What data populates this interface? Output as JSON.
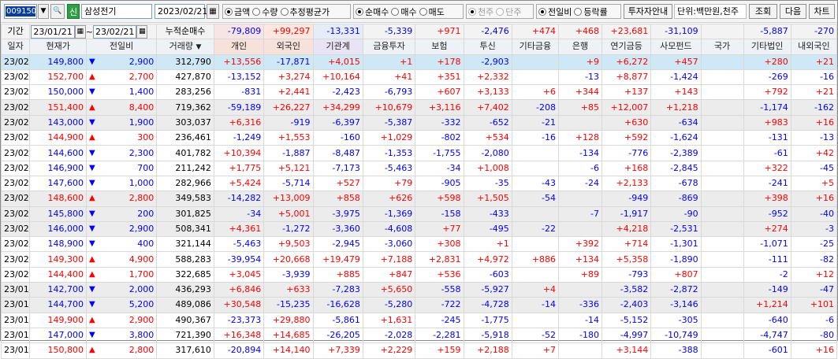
{
  "toolbar": {
    "code": "009150",
    "stock_name": "삼성전기",
    "sin_badge": "신",
    "date": "2023/02/21",
    "radio_group1": [
      {
        "label": "금액",
        "checked": true
      },
      {
        "label": "수량",
        "checked": false
      },
      {
        "label": "추정평균가",
        "checked": false
      }
    ],
    "radio_group2": [
      {
        "label": "순매수",
        "checked": true
      },
      {
        "label": "매수",
        "checked": false
      },
      {
        "label": "매도",
        "checked": false
      }
    ],
    "radio_group3": [
      {
        "label": "천주",
        "checked": true,
        "disabled": true
      },
      {
        "label": "단주",
        "checked": false,
        "disabled": true
      }
    ],
    "radio_group4": [
      {
        "label": "전일비",
        "checked": true
      },
      {
        "label": "등락률",
        "checked": false
      }
    ],
    "investor_btn": "투자자안내",
    "unit_label": "단위:백만원,천주",
    "query_btn": "조회",
    "next_btn": "다음",
    "chart_btn": "차트"
  },
  "period": {
    "label": "기간",
    "from": "23/01/21",
    "to": "23/02/21",
    "sep": "~",
    "cum_label": "누적순매수"
  },
  "summary": [
    "-79,809",
    "+99,297",
    "-13,331",
    "-5,339",
    "+971",
    "-2,476",
    "+474",
    "+468",
    "+23,681",
    "-31,109",
    "",
    "-5,887",
    "-270"
  ],
  "headers": [
    "일자",
    "현재가",
    "전일비",
    "거래량",
    "개인",
    "외국인",
    "기관계",
    "금융투자",
    "보험",
    "투신",
    "기타금융",
    "은행",
    "연기금등",
    "사모펀드",
    "국가",
    "기타법인",
    "내외국인"
  ],
  "rows": [
    {
      "date": "23/02/21",
      "price": "149,800",
      "dir": "dn",
      "chg": "2,900",
      "vol": "312,790",
      "v": [
        "+13,556",
        "-17,871",
        "+4,015",
        "+1",
        "+178",
        "-2,903",
        "",
        "+9",
        "+6,272",
        "+457",
        "",
        "+280",
        "+21"
      ]
    },
    {
      "date": "23/02/20",
      "price": "152,700",
      "dir": "up",
      "chg": "2,700",
      "vol": "427,870",
      "v": [
        "-13,152",
        "+3,274",
        "+10,164",
        "+41",
        "+351",
        "+2,332",
        "",
        "-13",
        "+8,877",
        "-1,424",
        "",
        "-269",
        "-16"
      ]
    },
    {
      "date": "23/02/17",
      "price": "150,000",
      "dir": "dn",
      "chg": "1,400",
      "vol": "283,256",
      "v": [
        "-831",
        "+2,441",
        "-2,423",
        "-6,793",
        "+607",
        "+3,133",
        "+6",
        "+344",
        "+137",
        "+143",
        "",
        "+792",
        "+21"
      ]
    },
    {
      "date": "23/02/16",
      "price": "151,400",
      "dir": "up",
      "chg": "8,400",
      "vol": "719,362",
      "v": [
        "-59,189",
        "+26,227",
        "+34,299",
        "+10,679",
        "+3,116",
        "+7,402",
        "-208",
        "+85",
        "+12,007",
        "+1,218",
        "",
        "-1,174",
        "-162"
      ]
    },
    {
      "date": "23/02/15",
      "price": "143,000",
      "dir": "dn",
      "chg": "1,900",
      "vol": "303,037",
      "v": [
        "+6,316",
        "-919",
        "-6,397",
        "-5,387",
        "-332",
        "-652",
        "-21",
        "",
        "+630",
        "-634",
        "",
        "+983",
        "+16"
      ]
    },
    {
      "date": "23/02/14",
      "price": "144,900",
      "dir": "up",
      "chg": "300",
      "vol": "236,461",
      "v": [
        "-1,249",
        "+1,553",
        "-160",
        "+1,029",
        "-802",
        "+534",
        "-16",
        "+128",
        "+592",
        "-1,624",
        "",
        "-131",
        "-13"
      ]
    },
    {
      "date": "23/02/13",
      "price": "144,600",
      "dir": "dn",
      "chg": "2,300",
      "vol": "401,782",
      "v": [
        "+10,394",
        "-1,887",
        "-8,487",
        "-1,353",
        "-1,755",
        "-2,080",
        "",
        "-134",
        "-776",
        "-2,389",
        "",
        "-61",
        "+42"
      ]
    },
    {
      "date": "23/02/10",
      "price": "146,900",
      "dir": "dn",
      "chg": "700",
      "vol": "211,242",
      "v": [
        "+1,775",
        "+5,121",
        "-7,173",
        "-5,463",
        "-34",
        "+1,008",
        "",
        "-6",
        "+168",
        "-2,845",
        "",
        "+322",
        "-45"
      ]
    },
    {
      "date": "23/02/09",
      "price": "147,600",
      "dir": "dn",
      "chg": "1,000",
      "vol": "282,966",
      "v": [
        "+5,424",
        "-5,714",
        "+527",
        "+79",
        "-905",
        "-35",
        "-43",
        "-24",
        "+2,133",
        "-678",
        "",
        "-241",
        "+5"
      ]
    },
    {
      "date": "23/02/08",
      "price": "148,600",
      "dir": "up",
      "chg": "2,800",
      "vol": "349,583",
      "v": [
        "-14,282",
        "+13,009",
        "+858",
        "+626",
        "+598",
        "+1,505",
        "-54",
        "",
        "-949",
        "-869",
        "",
        "+398",
        "+16"
      ]
    },
    {
      "date": "23/02/07",
      "price": "145,800",
      "dir": "dn",
      "chg": "200",
      "vol": "301,825",
      "v": [
        "-34",
        "+5,001",
        "-3,975",
        "-1,369",
        "-158",
        "-433",
        "",
        "-7",
        "-1,917",
        "-90",
        "",
        "-952",
        "-40"
      ]
    },
    {
      "date": "23/02/06",
      "price": "146,000",
      "dir": "dn",
      "chg": "2,900",
      "vol": "508,341",
      "v": [
        "+4,361",
        "-1,272",
        "-3,360",
        "-4,608",
        "+77",
        "-495",
        "-22",
        "",
        "+4,218",
        "-2,531",
        "",
        "+274",
        "-3"
      ]
    },
    {
      "date": "23/02/03",
      "price": "148,900",
      "dir": "dn",
      "chg": "400",
      "vol": "321,144",
      "v": [
        "-5,463",
        "+9,503",
        "-2,945",
        "-3,060",
        "+308",
        "+1",
        "",
        "+392",
        "+714",
        "-1,301",
        "",
        "-1,071",
        "-25"
      ]
    },
    {
      "date": "23/02/02",
      "price": "149,300",
      "dir": "up",
      "chg": "4,900",
      "vol": "588,283",
      "v": [
        "-39,954",
        "+20,668",
        "+19,479",
        "+7,188",
        "+2,831",
        "+4,972",
        "+886",
        "+134",
        "+5,358",
        "-1,890",
        "",
        "-111",
        "-82"
      ]
    },
    {
      "date": "23/02/01",
      "price": "144,400",
      "dir": "up",
      "chg": "1,700",
      "vol": "322,685",
      "v": [
        "+3,045",
        "-3,939",
        "+885",
        "+847",
        "+536",
        "-603",
        "",
        "+89",
        "-793",
        "+807",
        "",
        "-2",
        "+12"
      ]
    },
    {
      "date": "23/01/31",
      "price": "142,700",
      "dir": "dn",
      "chg": "2,000",
      "vol": "436,293",
      "v": [
        "+6,846",
        "+633",
        "-7,283",
        "+5,650",
        "-558",
        "-5,927",
        "+4",
        "",
        "-3,582",
        "-2,872",
        "",
        "-149",
        "-47"
      ]
    },
    {
      "date": "23/01/30",
      "price": "144,700",
      "dir": "dn",
      "chg": "5,200",
      "vol": "489,086",
      "v": [
        "+30,548",
        "-15,235",
        "-16,628",
        "-5,280",
        "-722",
        "-4,728",
        "-14",
        "-336",
        "-2,403",
        "-3,146",
        "",
        "+1,214",
        "+101"
      ]
    },
    {
      "date": "23/01/27",
      "price": "149,900",
      "dir": "up",
      "chg": "2,900",
      "vol": "490,367",
      "v": [
        "-23,373",
        "+29,880",
        "-5,861",
        "+1,631",
        "-245",
        "-1,775",
        "",
        "-14",
        "-5,152",
        "-305",
        "",
        "-640",
        "-6"
      ]
    },
    {
      "date": "23/01/26",
      "price": "147,000",
      "dir": "dn",
      "chg": "3,800",
      "vol": "721,390",
      "v": [
        "+16,348",
        "+14,685",
        "-26,205",
        "-2,028",
        "-2,281",
        "-5,918",
        "-52",
        "-180",
        "-4,997",
        "-10,749",
        "",
        "-4,747",
        "-80"
      ]
    },
    {
      "date": "23/01/25",
      "price": "150,800",
      "dir": "up",
      "chg": "2,800",
      "vol": "317,610",
      "v": [
        "-20,894",
        "+14,140",
        "+7,339",
        "+2,229",
        "+159",
        "+2,188",
        "+7",
        "",
        "+3,144",
        "-388",
        "",
        "-601",
        "+16"
      ]
    }
  ]
}
